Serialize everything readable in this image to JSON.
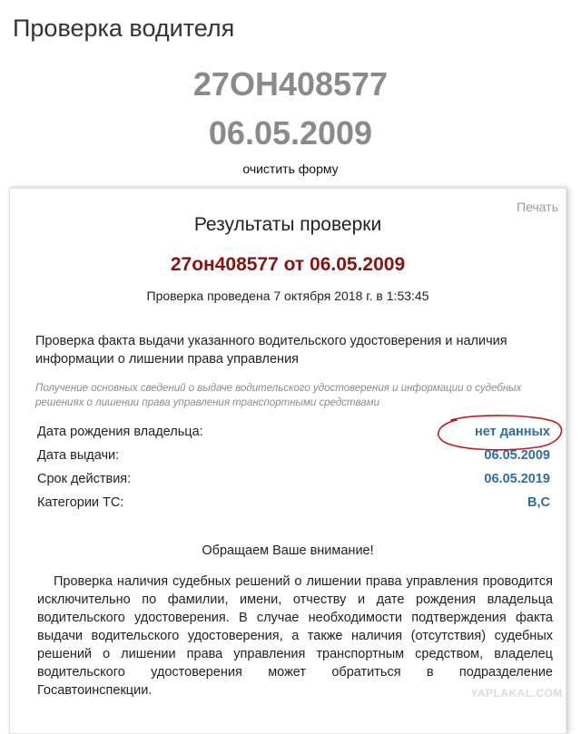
{
  "header": {
    "title": "Проверка водителя",
    "license_number": "27ОН408577",
    "issue_date": "06.05.2009",
    "clear_form_label": "очистить форму"
  },
  "results": {
    "print_label": "Печать",
    "title": "Результаты проверки",
    "subtitle": "27он408577 от 06.05.2009",
    "check_time": "Проверка проведена 7 октября 2018 г. в 1:53:45",
    "section_heading": "Проверка факта выдачи указанного водительского удостоверения и наличия информации о лишении права управления",
    "section_note": "Получение основных сведений о выдаче водительского удостоверения и информации о судебных решениях о лишении права управления транспортными средствами",
    "fields": [
      {
        "label": "Дата рождения владельца:",
        "value": "нет данных"
      },
      {
        "label": "Дата выдачи:",
        "value": "06.05.2009"
      },
      {
        "label": "Срок действия:",
        "value": "06.05.2019"
      },
      {
        "label": "Категории ТС:",
        "value": "B,C"
      }
    ],
    "notice_heading": "Обращаем Ваше внимание!",
    "notice_body": "Проверка наличия судебных решений о лишении права управления проводится исключительно по фамилии, имени, отчеству и дате рождения владельца водительского удостоверения. В случае необходимости подтверждения факта выдачи водительского удостоверения, а также наличия (отсутствия) судебных решений о лишении права управления транспортным средством, владелец водительского удостоверения может обратиться в подразделение Госавтоинспекции."
  },
  "watermark": "YAPLAKAL.COM",
  "colors": {
    "accent_value": "#2f6ea1",
    "subtitle_red": "#8b1111",
    "annotation_red": "#c41a1a"
  }
}
